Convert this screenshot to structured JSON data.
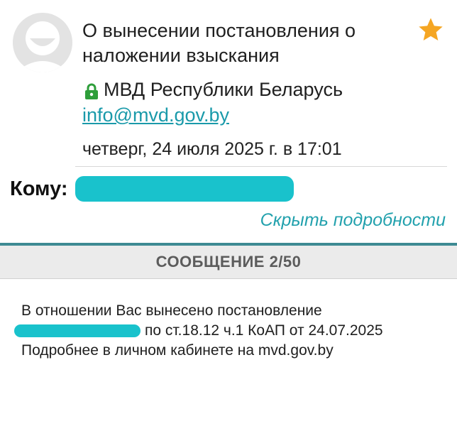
{
  "message": {
    "subject": "О вынесении постановления о наложении взыскания",
    "starred": true,
    "sender_name": "МВД Республики Беларусь",
    "sender_email": "info@mvd.gov.by",
    "date": "четверг, 24 июля 2025 г. в 17:01",
    "to_label": "Кому:",
    "hide_details_label": "Скрыть подробности",
    "counter_label": "СООБЩЕНИЕ 2/50",
    "body_line1": "В отношении Вас вынесено постановление",
    "body_line2_visible": "по ст.18.12 ч.1 КоАП от 24.07.2025",
    "body_line3": "Подробнее в личном кабинете на mvd.gov.by"
  },
  "colors": {
    "accent": "#22a1ad",
    "star": "#f5a623",
    "lock": "#2e9e3a",
    "redaction": "#19c2cc",
    "divider": "#3e8a93"
  },
  "icons": {
    "avatar": "default-avatar-icon",
    "star": "star-icon",
    "lock": "lock-icon"
  }
}
